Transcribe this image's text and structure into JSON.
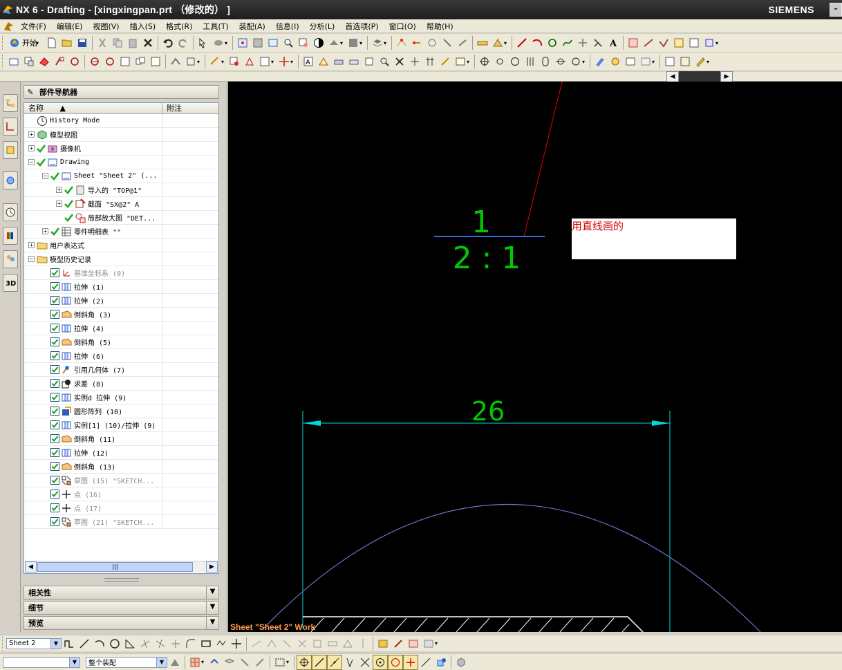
{
  "window": {
    "title": "NX 6 - Drafting - [xingxingpan.prt （修改的） ]",
    "brand": "SIEMENS"
  },
  "menu": [
    "文件(F)",
    "编辑(E)",
    "视图(V)",
    "插入(S)",
    "格式(R)",
    "工具(T)",
    "装配(A)",
    "信息(I)",
    "分析(L)",
    "首选项(P)",
    "窗口(O)",
    "帮助(H)"
  ],
  "toolbar": {
    "start_label": "开始"
  },
  "navigator": {
    "title": "部件导航器",
    "col_name": "名称",
    "col_note": "附注",
    "rows": [
      {
        "label": "History Mode",
        "dim": false
      },
      {
        "label": "模型视图",
        "dim": false
      },
      {
        "label": "摄像机",
        "dim": false
      },
      {
        "label": "Drawing",
        "dim": false
      },
      {
        "label": "Sheet \"Sheet 2\" (...",
        "dim": false
      },
      {
        "label": "导入的 \"TOP@1\"",
        "dim": false
      },
      {
        "label": "截面 \"SX@2\" A",
        "dim": false
      },
      {
        "label": "局部放大图 \"DET...",
        "dim": false
      },
      {
        "label": "零件明细表 \"\"",
        "dim": false
      },
      {
        "label": "用户表达式",
        "dim": false
      },
      {
        "label": "模型历史记录",
        "dim": false
      },
      {
        "label": "基准坐标系 (0)",
        "dim": true
      },
      {
        "label": "拉伸 (1)",
        "dim": false
      },
      {
        "label": "拉伸 (2)",
        "dim": false
      },
      {
        "label": "倒斜角 (3)",
        "dim": false
      },
      {
        "label": "拉伸 (4)",
        "dim": false
      },
      {
        "label": "倒斜角 (5)",
        "dim": false
      },
      {
        "label": "拉伸 (6)",
        "dim": false
      },
      {
        "label": "引用几何体 (7)",
        "dim": false
      },
      {
        "label": "求差 (8)",
        "dim": false
      },
      {
        "label": "实例d 拉伸 (9)",
        "dim": false
      },
      {
        "label": "圆形阵列 (10)",
        "dim": false
      },
      {
        "label": "实例[1] (10)/拉伸 (9)",
        "dim": false
      },
      {
        "label": "倒斜角 (11)",
        "dim": false
      },
      {
        "label": "拉伸 (12)",
        "dim": false
      },
      {
        "label": "倒斜角 (13)",
        "dim": false
      },
      {
        "label": "草图 (15) \"SKETCH...",
        "dim": true
      },
      {
        "label": "点 (16)",
        "dim": true
      },
      {
        "label": "点 (17)",
        "dim": true
      },
      {
        "label": "草图 (21) \"SKETCH...",
        "dim": true
      }
    ],
    "sections": [
      "相关性",
      "细节",
      "预览"
    ]
  },
  "canvas": {
    "scale_top": "1",
    "scale_bottom": "2 : 1",
    "dimension": "26",
    "annotation": "用直线画的",
    "status": "Sheet \"Sheet 2\" Work"
  },
  "bottom": {
    "sheet_combo": "Sheet 2",
    "filter_combo": "",
    "scope_combo": "整个装配"
  },
  "colors": {
    "titlebar": "#1e1e1e",
    "canvas_bg": "#000000",
    "dimension": "#00d8d8",
    "scale_text": "#00c800",
    "scale_line": "#2f6fe0",
    "leader": "#e00000",
    "arc": "#6b74c8",
    "status": "#ff9b4a"
  }
}
